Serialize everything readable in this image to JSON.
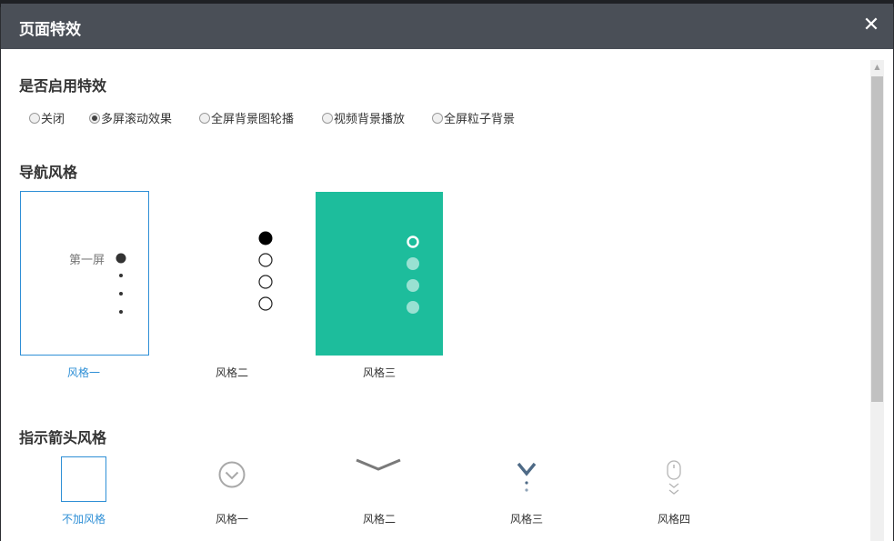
{
  "dialog": {
    "title": "页面特效",
    "close_label": "✕"
  },
  "effects": {
    "heading": "是否启用特效",
    "options": [
      {
        "label": "关闭",
        "selected": false
      },
      {
        "label": "多屏滚动效果",
        "selected": true
      },
      {
        "label": "全屏背景图轮播",
        "selected": false
      },
      {
        "label": "视频背景播放",
        "selected": false
      },
      {
        "label": "全屏粒子背景",
        "selected": false
      }
    ]
  },
  "nav_style": {
    "heading": "导航风格",
    "cards": [
      {
        "label": "风格一",
        "selected": true,
        "screen_text": "第一屏"
      },
      {
        "label": "风格二",
        "selected": false
      },
      {
        "label": "风格三",
        "selected": false,
        "bg_color": "#1dbd9c"
      }
    ]
  },
  "arrow_style": {
    "heading": "指示箭头风格",
    "items": [
      {
        "label": "不加风格",
        "selected": true,
        "icon": "empty-box-icon"
      },
      {
        "label": "风格一",
        "selected": false,
        "icon": "circle-chevron-down-icon"
      },
      {
        "label": "风格二",
        "selected": false,
        "icon": "wide-chevron-down-icon"
      },
      {
        "label": "风格三",
        "selected": false,
        "icon": "chevron-dots-icon"
      },
      {
        "label": "风格四",
        "selected": false,
        "icon": "mouse-scroll-icon"
      }
    ]
  },
  "colors": {
    "accent": "#2e8fd6",
    "titlebar": "#4a4f57",
    "teal": "#1dbd9c"
  }
}
